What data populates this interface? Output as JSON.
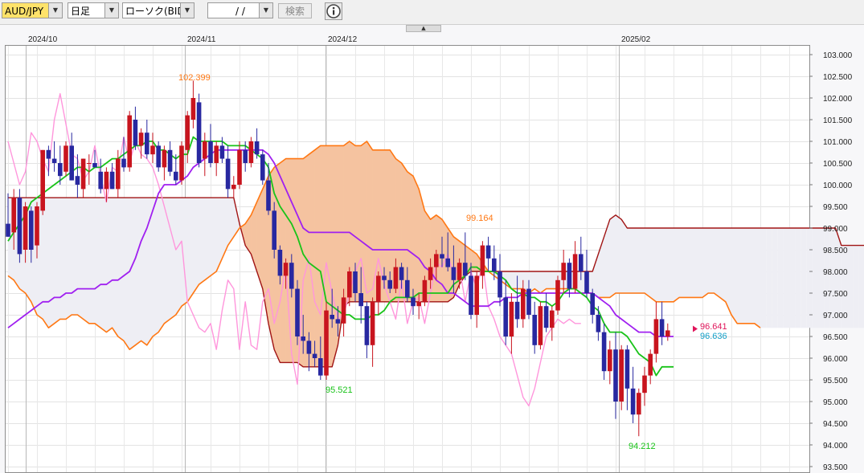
{
  "toolbar": {
    "symbol": "AUD/JPY",
    "period": "日足",
    "chart_type": "ローソク(BID)",
    "date": "/ /",
    "search_label": "検索",
    "info_icon": "info-icon"
  },
  "colors": {
    "bull": "#c8141e",
    "bear": "#2828a0",
    "tenkan": "#19c319",
    "kijun": "#a020f0",
    "chikou": "#ff96dc",
    "span_a": "#ff7814",
    "span_b": "#a01414",
    "cloud_up": "#f5c3a0",
    "cloud_down": "#eeeef4"
  },
  "chart_data": {
    "type": "candlestick",
    "indicator": "ichimoku",
    "x_labels": [
      "2024/10",
      "2024/11",
      "2024/12",
      "2025/02"
    ],
    "y_ticks": [
      "103.000",
      "102.500",
      "102.000",
      "101.500",
      "101.000",
      "100.500",
      "100.000",
      "99.500",
      "99.000",
      "98.500",
      "98.000",
      "97.500",
      "97.000",
      "96.500",
      "96.000",
      "95.500",
      "95.000",
      "94.500",
      "94.000",
      "93.500"
    ],
    "ylim": [
      93.5,
      103.25
    ],
    "annotations": [
      {
        "text": "102.399",
        "value": 102.399,
        "color": "#ff7814"
      },
      {
        "text": "99.164",
        "value": 99.164,
        "color": "#ff7814"
      },
      {
        "text": "95.521",
        "value": 95.521,
        "color": "#19c319"
      },
      {
        "text": "94.212",
        "value": 94.212,
        "color": "#19c319"
      }
    ],
    "price_tags": [
      {
        "text": "96.641",
        "color": "#e0145a"
      },
      {
        "text": "96.636",
        "color": "#14a0c8"
      }
    ],
    "candles": [
      [
        99.1,
        99.8,
        98.8,
        98.8
      ],
      [
        98.9,
        99.9,
        98.5,
        99.7
      ],
      [
        99.7,
        99.9,
        98.2,
        98.4
      ],
      [
        98.5,
        99.6,
        98.2,
        99.5
      ],
      [
        99.4,
        99.5,
        98.2,
        98.5
      ],
      [
        98.6,
        99.6,
        98.3,
        99.5
      ],
      [
        99.4,
        100.8,
        99.3,
        100.8
      ],
      [
        100.8,
        100.9,
        100.2,
        100.6
      ],
      [
        100.6,
        101.0,
        100.3,
        100.5
      ],
      [
        100.5,
        100.9,
        100.0,
        100.2
      ],
      [
        100.3,
        101.0,
        100.2,
        100.9
      ],
      [
        100.9,
        101.2,
        100.1,
        100.1
      ],
      [
        100.2,
        100.7,
        99.7,
        100.0
      ],
      [
        99.9,
        100.6,
        99.7,
        100.6
      ],
      [
        100.5,
        100.7,
        100.0,
        100.5
      ],
      [
        100.5,
        100.8,
        100.4,
        100.4
      ],
      [
        100.3,
        100.6,
        99.8,
        99.9
      ],
      [
        99.9,
        100.4,
        99.6,
        100.3
      ],
      [
        100.3,
        100.5,
        99.9,
        99.9
      ],
      [
        99.9,
        100.8,
        99.7,
        100.6
      ],
      [
        100.6,
        101.1,
        100.3,
        100.4
      ],
      [
        100.4,
        101.7,
        100.3,
        101.6
      ],
      [
        101.5,
        101.8,
        100.8,
        100.9
      ],
      [
        100.9,
        101.3,
        100.6,
        101.2
      ],
      [
        101.2,
        101.5,
        100.6,
        100.7
      ],
      [
        100.7,
        101.2,
        100.5,
        100.9
      ],
      [
        100.9,
        101.0,
        100.3,
        100.4
      ],
      [
        100.4,
        100.9,
        100.1,
        100.8
      ],
      [
        100.8,
        101.0,
        100.2,
        100.3
      ],
      [
        100.3,
        100.7,
        100.0,
        100.1
      ],
      [
        100.1,
        101.0,
        100.0,
        100.9
      ],
      [
        100.8,
        101.7,
        100.5,
        101.6
      ],
      [
        101.5,
        102.4,
        101.3,
        102.0
      ],
      [
        101.9,
        102.1,
        100.4,
        100.5
      ],
      [
        100.6,
        101.2,
        100.2,
        101.0
      ],
      [
        101.0,
        101.4,
        100.4,
        100.5
      ],
      [
        100.5,
        101.0,
        100.2,
        100.9
      ],
      [
        100.9,
        101.1,
        100.5,
        100.6
      ],
      [
        100.6,
        100.9,
        99.7,
        99.9
      ],
      [
        99.9,
        100.2,
        99.7,
        100.0
      ],
      [
        100.0,
        101.0,
        99.9,
        100.8
      ],
      [
        100.8,
        101.0,
        100.3,
        100.5
      ],
      [
        100.5,
        101.1,
        100.4,
        101.0
      ],
      [
        101.0,
        101.3,
        100.6,
        100.7
      ],
      [
        100.7,
        100.8,
        100.0,
        100.1
      ],
      [
        100.1,
        100.5,
        99.3,
        99.4
      ],
      [
        99.4,
        99.6,
        98.3,
        98.5
      ],
      [
        98.5,
        98.6,
        97.7,
        97.9
      ],
      [
        97.9,
        98.3,
        97.6,
        98.2
      ],
      [
        98.2,
        98.4,
        97.4,
        97.6
      ],
      [
        97.6,
        97.8,
        96.3,
        96.5
      ],
      [
        96.5,
        97.0,
        96.1,
        96.4
      ],
      [
        96.4,
        96.6,
        95.7,
        96.1
      ],
      [
        96.1,
        96.4,
        95.8,
        96.0
      ],
      [
        96.0,
        96.5,
        95.5,
        95.6
      ],
      [
        95.6,
        97.3,
        95.5,
        97.1
      ],
      [
        97.0,
        97.6,
        96.7,
        96.9
      ],
      [
        96.9,
        97.2,
        96.5,
        96.8
      ],
      [
        96.8,
        97.6,
        96.5,
        97.4
      ],
      [
        97.4,
        98.1,
        97.2,
        98.0
      ],
      [
        98.0,
        98.2,
        97.3,
        97.5
      ],
      [
        97.5,
        98.1,
        96.8,
        97.2
      ],
      [
        97.2,
        97.3,
        96.0,
        96.3
      ],
      [
        96.3,
        97.4,
        95.8,
        97.3
      ],
      [
        97.3,
        98.0,
        97.0,
        97.9
      ],
      [
        97.9,
        98.1,
        97.6,
        97.8
      ],
      [
        97.8,
        98.0,
        97.5,
        97.6
      ],
      [
        97.6,
        98.3,
        97.5,
        98.1
      ],
      [
        98.1,
        98.2,
        97.6,
        97.8
      ],
      [
        97.8,
        98.1,
        97.3,
        97.4
      ],
      [
        97.4,
        97.6,
        97.0,
        97.2
      ],
      [
        97.2,
        97.5,
        96.9,
        97.3
      ],
      [
        97.3,
        97.9,
        97.2,
        97.8
      ],
      [
        97.8,
        98.3,
        97.6,
        98.1
      ],
      [
        98.1,
        98.5,
        97.8,
        98.4
      ],
      [
        98.4,
        98.8,
        98.1,
        98.3
      ],
      [
        98.3,
        98.9,
        98.0,
        98.1
      ],
      [
        98.1,
        98.6,
        97.5,
        97.8
      ],
      [
        97.8,
        98.3,
        97.6,
        98.2
      ],
      [
        98.2,
        98.9,
        97.8,
        97.9
      ],
      [
        97.9,
        98.2,
        96.9,
        97.0
      ],
      [
        97.0,
        98.0,
        96.7,
        97.9
      ],
      [
        97.9,
        98.7,
        97.6,
        98.6
      ],
      [
        98.6,
        98.8,
        98.0,
        98.3
      ],
      [
        98.3,
        98.6,
        97.8,
        98.0
      ],
      [
        98.0,
        98.4,
        97.2,
        97.4
      ],
      [
        97.4,
        97.8,
        96.3,
        96.5
      ],
      [
        96.5,
        97.5,
        96.1,
        97.3
      ],
      [
        97.3,
        97.9,
        96.7,
        96.9
      ],
      [
        96.9,
        97.8,
        96.7,
        97.6
      ],
      [
        97.6,
        97.8,
        96.9,
        97.0
      ],
      [
        97.0,
        97.3,
        96.1,
        96.3
      ],
      [
        96.3,
        97.3,
        96.2,
        97.2
      ],
      [
        97.2,
        97.5,
        96.6,
        96.7
      ],
      [
        96.7,
        97.2,
        96.4,
        97.1
      ],
      [
        97.1,
        97.9,
        97.0,
        97.8
      ],
      [
        97.8,
        98.5,
        97.5,
        98.2
      ],
      [
        98.2,
        98.3,
        97.4,
        97.6
      ],
      [
        97.6,
        98.7,
        97.5,
        98.4
      ],
      [
        98.4,
        98.8,
        97.8,
        98.0
      ],
      [
        98.0,
        98.5,
        97.4,
        97.5
      ],
      [
        97.5,
        97.6,
        96.8,
        97.0
      ],
      [
        97.0,
        97.2,
        96.4,
        96.6
      ],
      [
        96.6,
        96.8,
        95.5,
        95.7
      ],
      [
        95.7,
        96.4,
        95.4,
        96.2
      ],
      [
        96.2,
        96.6,
        94.6,
        95.0
      ],
      [
        95.0,
        96.3,
        94.8,
        96.2
      ],
      [
        96.2,
        96.3,
        94.8,
        95.3
      ],
      [
        95.3,
        95.8,
        94.5,
        94.7
      ],
      [
        94.7,
        95.3,
        94.2,
        95.2
      ],
      [
        95.2,
        95.8,
        94.9,
        95.6
      ],
      [
        95.6,
        96.2,
        95.4,
        96.1
      ],
      [
        96.1,
        97.3,
        95.9,
        96.9
      ],
      [
        96.9,
        97.3,
        96.3,
        96.5
      ],
      [
        96.5,
        96.8,
        96.4,
        96.64
      ]
    ],
    "tenkan": [
      98.7,
      98.9,
      99.1,
      99.3,
      99.6,
      99.7,
      99.8,
      99.9,
      100.0,
      100.1,
      100.2,
      100.3,
      100.4,
      100.4,
      100.3,
      100.4,
      100.4,
      100.5,
      100.6,
      100.6,
      100.7,
      100.8,
      100.9,
      100.9,
      101.0,
      101.0,
      100.8,
      100.8,
      100.7,
      100.6,
      100.7,
      100.7,
      101.1,
      101.0,
      101.0,
      101.0,
      101.0,
      101.0,
      100.9,
      100.9,
      100.9,
      100.9,
      100.8,
      100.7,
      100.6,
      100.4,
      99.8,
      99.5,
      99.3,
      99.1,
      98.8,
      98.4,
      98.2,
      98.1,
      98.0,
      97.3,
      97.2,
      97.1,
      97.0,
      97.0,
      96.9,
      96.9,
      96.9,
      97.0,
      97.0,
      97.1,
      97.3,
      97.4,
      97.4,
      97.4,
      97.4,
      97.5,
      97.5,
      97.5,
      97.5,
      97.5,
      97.5,
      97.7,
      97.8,
      97.9,
      98.1,
      98.1,
      98.0,
      98.0,
      98.0,
      97.9,
      97.8,
      97.6,
      97.5,
      97.5,
      97.4,
      97.4,
      97.3,
      97.3,
      97.2,
      97.3,
      97.5,
      97.6,
      97.6,
      97.5,
      97.4,
      97.2,
      97.1,
      96.8,
      96.6,
      96.6,
      96.6,
      96.5,
      96.3,
      96.1,
      96.0,
      95.9,
      95.6,
      95.8,
      95.8,
      95.8
    ],
    "kijun": [
      96.7,
      96.8,
      96.9,
      97.0,
      97.1,
      97.2,
      97.3,
      97.3,
      97.4,
      97.4,
      97.5,
      97.5,
      97.6,
      97.6,
      97.6,
      97.6,
      97.7,
      97.7,
      97.8,
      97.8,
      97.9,
      98.0,
      98.3,
      98.7,
      99.0,
      99.4,
      99.8,
      100.0,
      100.0,
      100.0,
      100.1,
      100.2,
      100.4,
      100.5,
      100.6,
      100.7,
      100.8,
      100.8,
      100.8,
      100.8,
      100.8,
      100.8,
      100.8,
      100.8,
      100.8,
      100.7,
      100.5,
      100.2,
      99.9,
      99.6,
      99.3,
      99.0,
      98.9,
      98.9,
      98.9,
      98.9,
      98.9,
      98.9,
      98.9,
      98.9,
      98.8,
      98.7,
      98.6,
      98.5,
      98.5,
      98.5,
      98.5,
      98.5,
      98.5,
      98.5,
      98.4,
      98.3,
      98.1,
      98.0,
      97.8,
      97.7,
      97.5,
      97.5,
      97.4,
      97.3,
      97.2,
      97.2,
      97.2,
      97.2,
      97.3,
      97.3,
      97.4,
      97.4,
      97.4,
      97.5,
      97.5,
      97.5,
      97.5,
      97.5,
      97.5,
      97.5,
      97.5,
      97.5,
      97.5,
      97.5,
      97.5,
      97.5,
      97.4,
      97.3,
      97.2,
      97.0,
      96.9,
      96.8,
      96.7,
      96.6,
      96.6,
      96.6,
      96.5,
      96.5,
      96.5,
      96.5
    ],
    "span_a": [
      97.9,
      97.8,
      97.6,
      97.5,
      97.3,
      97.0,
      96.9,
      96.7,
      96.8,
      96.9,
      96.9,
      97.0,
      97.0,
      96.9,
      96.8,
      96.8,
      96.7,
      96.6,
      96.7,
      96.5,
      96.4,
      96.2,
      96.3,
      96.4,
      96.3,
      96.5,
      96.6,
      96.8,
      96.9,
      97.0,
      97.2,
      97.3,
      97.5,
      97.7,
      97.8,
      97.9,
      98.0,
      98.3,
      98.6,
      98.8,
      99.0,
      99.1,
      99.3,
      99.6,
      99.9,
      100.2,
      100.4,
      100.5,
      100.6,
      100.6,
      100.6,
      100.6,
      100.7,
      100.8,
      100.9,
      100.9,
      100.9,
      100.9,
      100.9,
      101.0,
      100.9,
      100.9,
      101.0,
      100.8,
      100.8,
      100.8,
      100.8,
      100.6,
      100.5,
      100.3,
      100.2,
      99.9,
      99.4,
      99.2,
      99.3,
      99.2,
      99.0,
      98.8,
      98.7,
      98.6,
      98.5,
      98.4,
      98.2,
      98.0,
      97.9,
      97.8,
      97.7,
      97.6,
      97.6,
      97.6,
      97.5,
      97.6,
      97.5,
      97.6,
      97.6,
      97.6,
      97.6,
      97.6,
      97.6,
      97.5,
      97.5,
      97.5,
      97.4,
      97.4,
      97.4,
      97.5,
      97.5,
      97.5,
      97.5,
      97.5,
      97.5,
      97.4,
      97.3,
      97.3,
      97.3,
      97.3,
      97.4,
      97.4,
      97.4,
      97.4,
      97.4,
      97.5,
      97.5,
      97.4,
      97.3,
      97.0,
      96.8,
      96.8,
      96.8,
      96.8,
      96.7
    ],
    "span_b": [
      99.7,
      99.7,
      99.7,
      99.7,
      99.7,
      99.7,
      99.7,
      99.7,
      99.7,
      99.7,
      99.7,
      99.7,
      99.7,
      99.7,
      99.7,
      99.7,
      99.7,
      99.7,
      99.7,
      99.7,
      99.7,
      99.7,
      99.7,
      99.7,
      99.7,
      99.7,
      99.7,
      99.7,
      99.7,
      99.7,
      99.7,
      99.7,
      99.7,
      99.7,
      99.7,
      99.7,
      99.7,
      99.7,
      99.7,
      99.7,
      99.1,
      98.6,
      98.4,
      98.0,
      97.6,
      96.8,
      96.2,
      95.9,
      95.9,
      95.9,
      95.9,
      95.8,
      95.8,
      95.8,
      95.8,
      95.8,
      95.8,
      96.3,
      97.2,
      97.3,
      97.3,
      97.3,
      97.3,
      97.3,
      97.3,
      97.3,
      97.3,
      97.3,
      97.3,
      97.3,
      97.3,
      97.3,
      97.3,
      97.3,
      97.3,
      97.3,
      97.3,
      97.4,
      97.7,
      97.9,
      98.0,
      98.0,
      98.0,
      98.0,
      98.0,
      98.0,
      98.0,
      98.0,
      98.0,
      98.0,
      98.0,
      98.0,
      98.0,
      98.0,
      98.0,
      98.0,
      98.0,
      98.0,
      98.0,
      98.0,
      98.0,
      98.0,
      98.4,
      98.8,
      99.2,
      99.3,
      99.2,
      99.0,
      99.0,
      99.0,
      99.0,
      99.0,
      99.0,
      99.0,
      99.0,
      99.0,
      99.0,
      99.0,
      99.0,
      99.0,
      99.0,
      99.0,
      99.0,
      99.0,
      99.0,
      99.0,
      99.0,
      99.0,
      99.0,
      99.0,
      99.0,
      99.0,
      99.0,
      99.0,
      99.0,
      99.0,
      99.0,
      99.0,
      99.0,
      99.0,
      99.0,
      99.0,
      99.0,
      99.0,
      98.6,
      98.6,
      98.6,
      98.6,
      98.6,
      98.6,
      98.6,
      98.6,
      98.6,
      98.6,
      98.6,
      98.6,
      98.6,
      98.6,
      98.6,
      98.6,
      98.2,
      97.9,
      97.9,
      97.9,
      97.8,
      97.6
    ],
    "chikou": [
      101.0,
      100.5,
      100.0,
      100.3,
      101.2,
      101.0,
      100.6,
      100.3,
      101.5,
      102.1,
      101.4,
      100.7,
      100.6,
      100.1,
      100.3,
      100.9,
      100.2,
      99.6,
      100.4,
      100.3,
      101.1,
      100.5,
      101.0,
      100.7,
      100.6,
      100.4,
      100.0,
      99.5,
      99.0,
      98.5,
      98.7,
      97.3,
      97.0,
      96.7,
      96.6,
      96.8,
      96.2,
      97.1,
      97.8,
      97.6,
      96.2,
      97.3,
      96.3,
      96.2,
      97.3,
      97.6,
      96.8,
      97.3,
      98.1,
      96.1,
      95.4,
      97.8,
      98.3,
      97.3,
      97.0,
      98.2,
      97.5,
      96.9,
      97.0,
      97.5,
      98.0,
      98.3,
      97.5,
      97.6,
      98.3,
      97.7,
      97.3,
      96.9,
      97.8,
      96.8,
      97.3,
      97.4,
      96.8,
      97.5,
      98.2,
      98.1,
      98.4,
      97.9,
      98.1,
      97.3,
      98.0,
      97.6,
      98.2,
      97.2,
      96.9,
      96.5,
      96.3,
      96.1,
      95.6,
      95.1,
      94.9,
      95.3,
      95.9,
      96.5,
      96.7,
      96.9,
      96.8,
      96.9,
      96.8,
      96.8
    ]
  }
}
